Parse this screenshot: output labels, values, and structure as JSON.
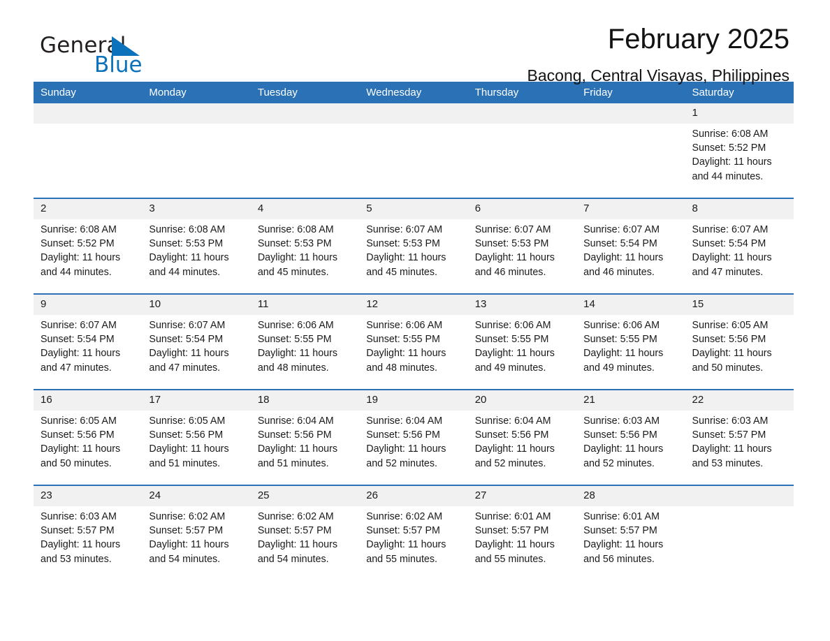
{
  "logo": {
    "general": "General",
    "blue": "Blue",
    "triangle_color": "#0b72bb"
  },
  "header": {
    "title": "February 2025",
    "subtitle": "Bacong, Central Visayas, Philippines",
    "accent_color": "#2a72b5",
    "daynum_bg": "#f1f1f1"
  },
  "weekdays": [
    "Sunday",
    "Monday",
    "Tuesday",
    "Wednesday",
    "Thursday",
    "Friday",
    "Saturday"
  ],
  "weeks": [
    [
      {
        "day": "",
        "sunrise": "",
        "sunset": "",
        "daylight_1": "",
        "daylight_2": ""
      },
      {
        "day": "",
        "sunrise": "",
        "sunset": "",
        "daylight_1": "",
        "daylight_2": ""
      },
      {
        "day": "",
        "sunrise": "",
        "sunset": "",
        "daylight_1": "",
        "daylight_2": ""
      },
      {
        "day": "",
        "sunrise": "",
        "sunset": "",
        "daylight_1": "",
        "daylight_2": ""
      },
      {
        "day": "",
        "sunrise": "",
        "sunset": "",
        "daylight_1": "",
        "daylight_2": ""
      },
      {
        "day": "",
        "sunrise": "",
        "sunset": "",
        "daylight_1": "",
        "daylight_2": ""
      },
      {
        "day": "1",
        "sunrise": "Sunrise: 6:08 AM",
        "sunset": "Sunset: 5:52 PM",
        "daylight_1": "Daylight: 11 hours",
        "daylight_2": "and 44 minutes."
      }
    ],
    [
      {
        "day": "2",
        "sunrise": "Sunrise: 6:08 AM",
        "sunset": "Sunset: 5:52 PM",
        "daylight_1": "Daylight: 11 hours",
        "daylight_2": "and 44 minutes."
      },
      {
        "day": "3",
        "sunrise": "Sunrise: 6:08 AM",
        "sunset": "Sunset: 5:53 PM",
        "daylight_1": "Daylight: 11 hours",
        "daylight_2": "and 44 minutes."
      },
      {
        "day": "4",
        "sunrise": "Sunrise: 6:08 AM",
        "sunset": "Sunset: 5:53 PM",
        "daylight_1": "Daylight: 11 hours",
        "daylight_2": "and 45 minutes."
      },
      {
        "day": "5",
        "sunrise": "Sunrise: 6:07 AM",
        "sunset": "Sunset: 5:53 PM",
        "daylight_1": "Daylight: 11 hours",
        "daylight_2": "and 45 minutes."
      },
      {
        "day": "6",
        "sunrise": "Sunrise: 6:07 AM",
        "sunset": "Sunset: 5:53 PM",
        "daylight_1": "Daylight: 11 hours",
        "daylight_2": "and 46 minutes."
      },
      {
        "day": "7",
        "sunrise": "Sunrise: 6:07 AM",
        "sunset": "Sunset: 5:54 PM",
        "daylight_1": "Daylight: 11 hours",
        "daylight_2": "and 46 minutes."
      },
      {
        "day": "8",
        "sunrise": "Sunrise: 6:07 AM",
        "sunset": "Sunset: 5:54 PM",
        "daylight_1": "Daylight: 11 hours",
        "daylight_2": "and 47 minutes."
      }
    ],
    [
      {
        "day": "9",
        "sunrise": "Sunrise: 6:07 AM",
        "sunset": "Sunset: 5:54 PM",
        "daylight_1": "Daylight: 11 hours",
        "daylight_2": "and 47 minutes."
      },
      {
        "day": "10",
        "sunrise": "Sunrise: 6:07 AM",
        "sunset": "Sunset: 5:54 PM",
        "daylight_1": "Daylight: 11 hours",
        "daylight_2": "and 47 minutes."
      },
      {
        "day": "11",
        "sunrise": "Sunrise: 6:06 AM",
        "sunset": "Sunset: 5:55 PM",
        "daylight_1": "Daylight: 11 hours",
        "daylight_2": "and 48 minutes."
      },
      {
        "day": "12",
        "sunrise": "Sunrise: 6:06 AM",
        "sunset": "Sunset: 5:55 PM",
        "daylight_1": "Daylight: 11 hours",
        "daylight_2": "and 48 minutes."
      },
      {
        "day": "13",
        "sunrise": "Sunrise: 6:06 AM",
        "sunset": "Sunset: 5:55 PM",
        "daylight_1": "Daylight: 11 hours",
        "daylight_2": "and 49 minutes."
      },
      {
        "day": "14",
        "sunrise": "Sunrise: 6:06 AM",
        "sunset": "Sunset: 5:55 PM",
        "daylight_1": "Daylight: 11 hours",
        "daylight_2": "and 49 minutes."
      },
      {
        "day": "15",
        "sunrise": "Sunrise: 6:05 AM",
        "sunset": "Sunset: 5:56 PM",
        "daylight_1": "Daylight: 11 hours",
        "daylight_2": "and 50 minutes."
      }
    ],
    [
      {
        "day": "16",
        "sunrise": "Sunrise: 6:05 AM",
        "sunset": "Sunset: 5:56 PM",
        "daylight_1": "Daylight: 11 hours",
        "daylight_2": "and 50 minutes."
      },
      {
        "day": "17",
        "sunrise": "Sunrise: 6:05 AM",
        "sunset": "Sunset: 5:56 PM",
        "daylight_1": "Daylight: 11 hours",
        "daylight_2": "and 51 minutes."
      },
      {
        "day": "18",
        "sunrise": "Sunrise: 6:04 AM",
        "sunset": "Sunset: 5:56 PM",
        "daylight_1": "Daylight: 11 hours",
        "daylight_2": "and 51 minutes."
      },
      {
        "day": "19",
        "sunrise": "Sunrise: 6:04 AM",
        "sunset": "Sunset: 5:56 PM",
        "daylight_1": "Daylight: 11 hours",
        "daylight_2": "and 52 minutes."
      },
      {
        "day": "20",
        "sunrise": "Sunrise: 6:04 AM",
        "sunset": "Sunset: 5:56 PM",
        "daylight_1": "Daylight: 11 hours",
        "daylight_2": "and 52 minutes."
      },
      {
        "day": "21",
        "sunrise": "Sunrise: 6:03 AM",
        "sunset": "Sunset: 5:56 PM",
        "daylight_1": "Daylight: 11 hours",
        "daylight_2": "and 52 minutes."
      },
      {
        "day": "22",
        "sunrise": "Sunrise: 6:03 AM",
        "sunset": "Sunset: 5:57 PM",
        "daylight_1": "Daylight: 11 hours",
        "daylight_2": "and 53 minutes."
      }
    ],
    [
      {
        "day": "23",
        "sunrise": "Sunrise: 6:03 AM",
        "sunset": "Sunset: 5:57 PM",
        "daylight_1": "Daylight: 11 hours",
        "daylight_2": "and 53 minutes."
      },
      {
        "day": "24",
        "sunrise": "Sunrise: 6:02 AM",
        "sunset": "Sunset: 5:57 PM",
        "daylight_1": "Daylight: 11 hours",
        "daylight_2": "and 54 minutes."
      },
      {
        "day": "25",
        "sunrise": "Sunrise: 6:02 AM",
        "sunset": "Sunset: 5:57 PM",
        "daylight_1": "Daylight: 11 hours",
        "daylight_2": "and 54 minutes."
      },
      {
        "day": "26",
        "sunrise": "Sunrise: 6:02 AM",
        "sunset": "Sunset: 5:57 PM",
        "daylight_1": "Daylight: 11 hours",
        "daylight_2": "and 55 minutes."
      },
      {
        "day": "27",
        "sunrise": "Sunrise: 6:01 AM",
        "sunset": "Sunset: 5:57 PM",
        "daylight_1": "Daylight: 11 hours",
        "daylight_2": "and 55 minutes."
      },
      {
        "day": "28",
        "sunrise": "Sunrise: 6:01 AM",
        "sunset": "Sunset: 5:57 PM",
        "daylight_1": "Daylight: 11 hours",
        "daylight_2": "and 56 minutes."
      },
      {
        "day": "",
        "sunrise": "",
        "sunset": "",
        "daylight_1": "",
        "daylight_2": ""
      }
    ]
  ]
}
